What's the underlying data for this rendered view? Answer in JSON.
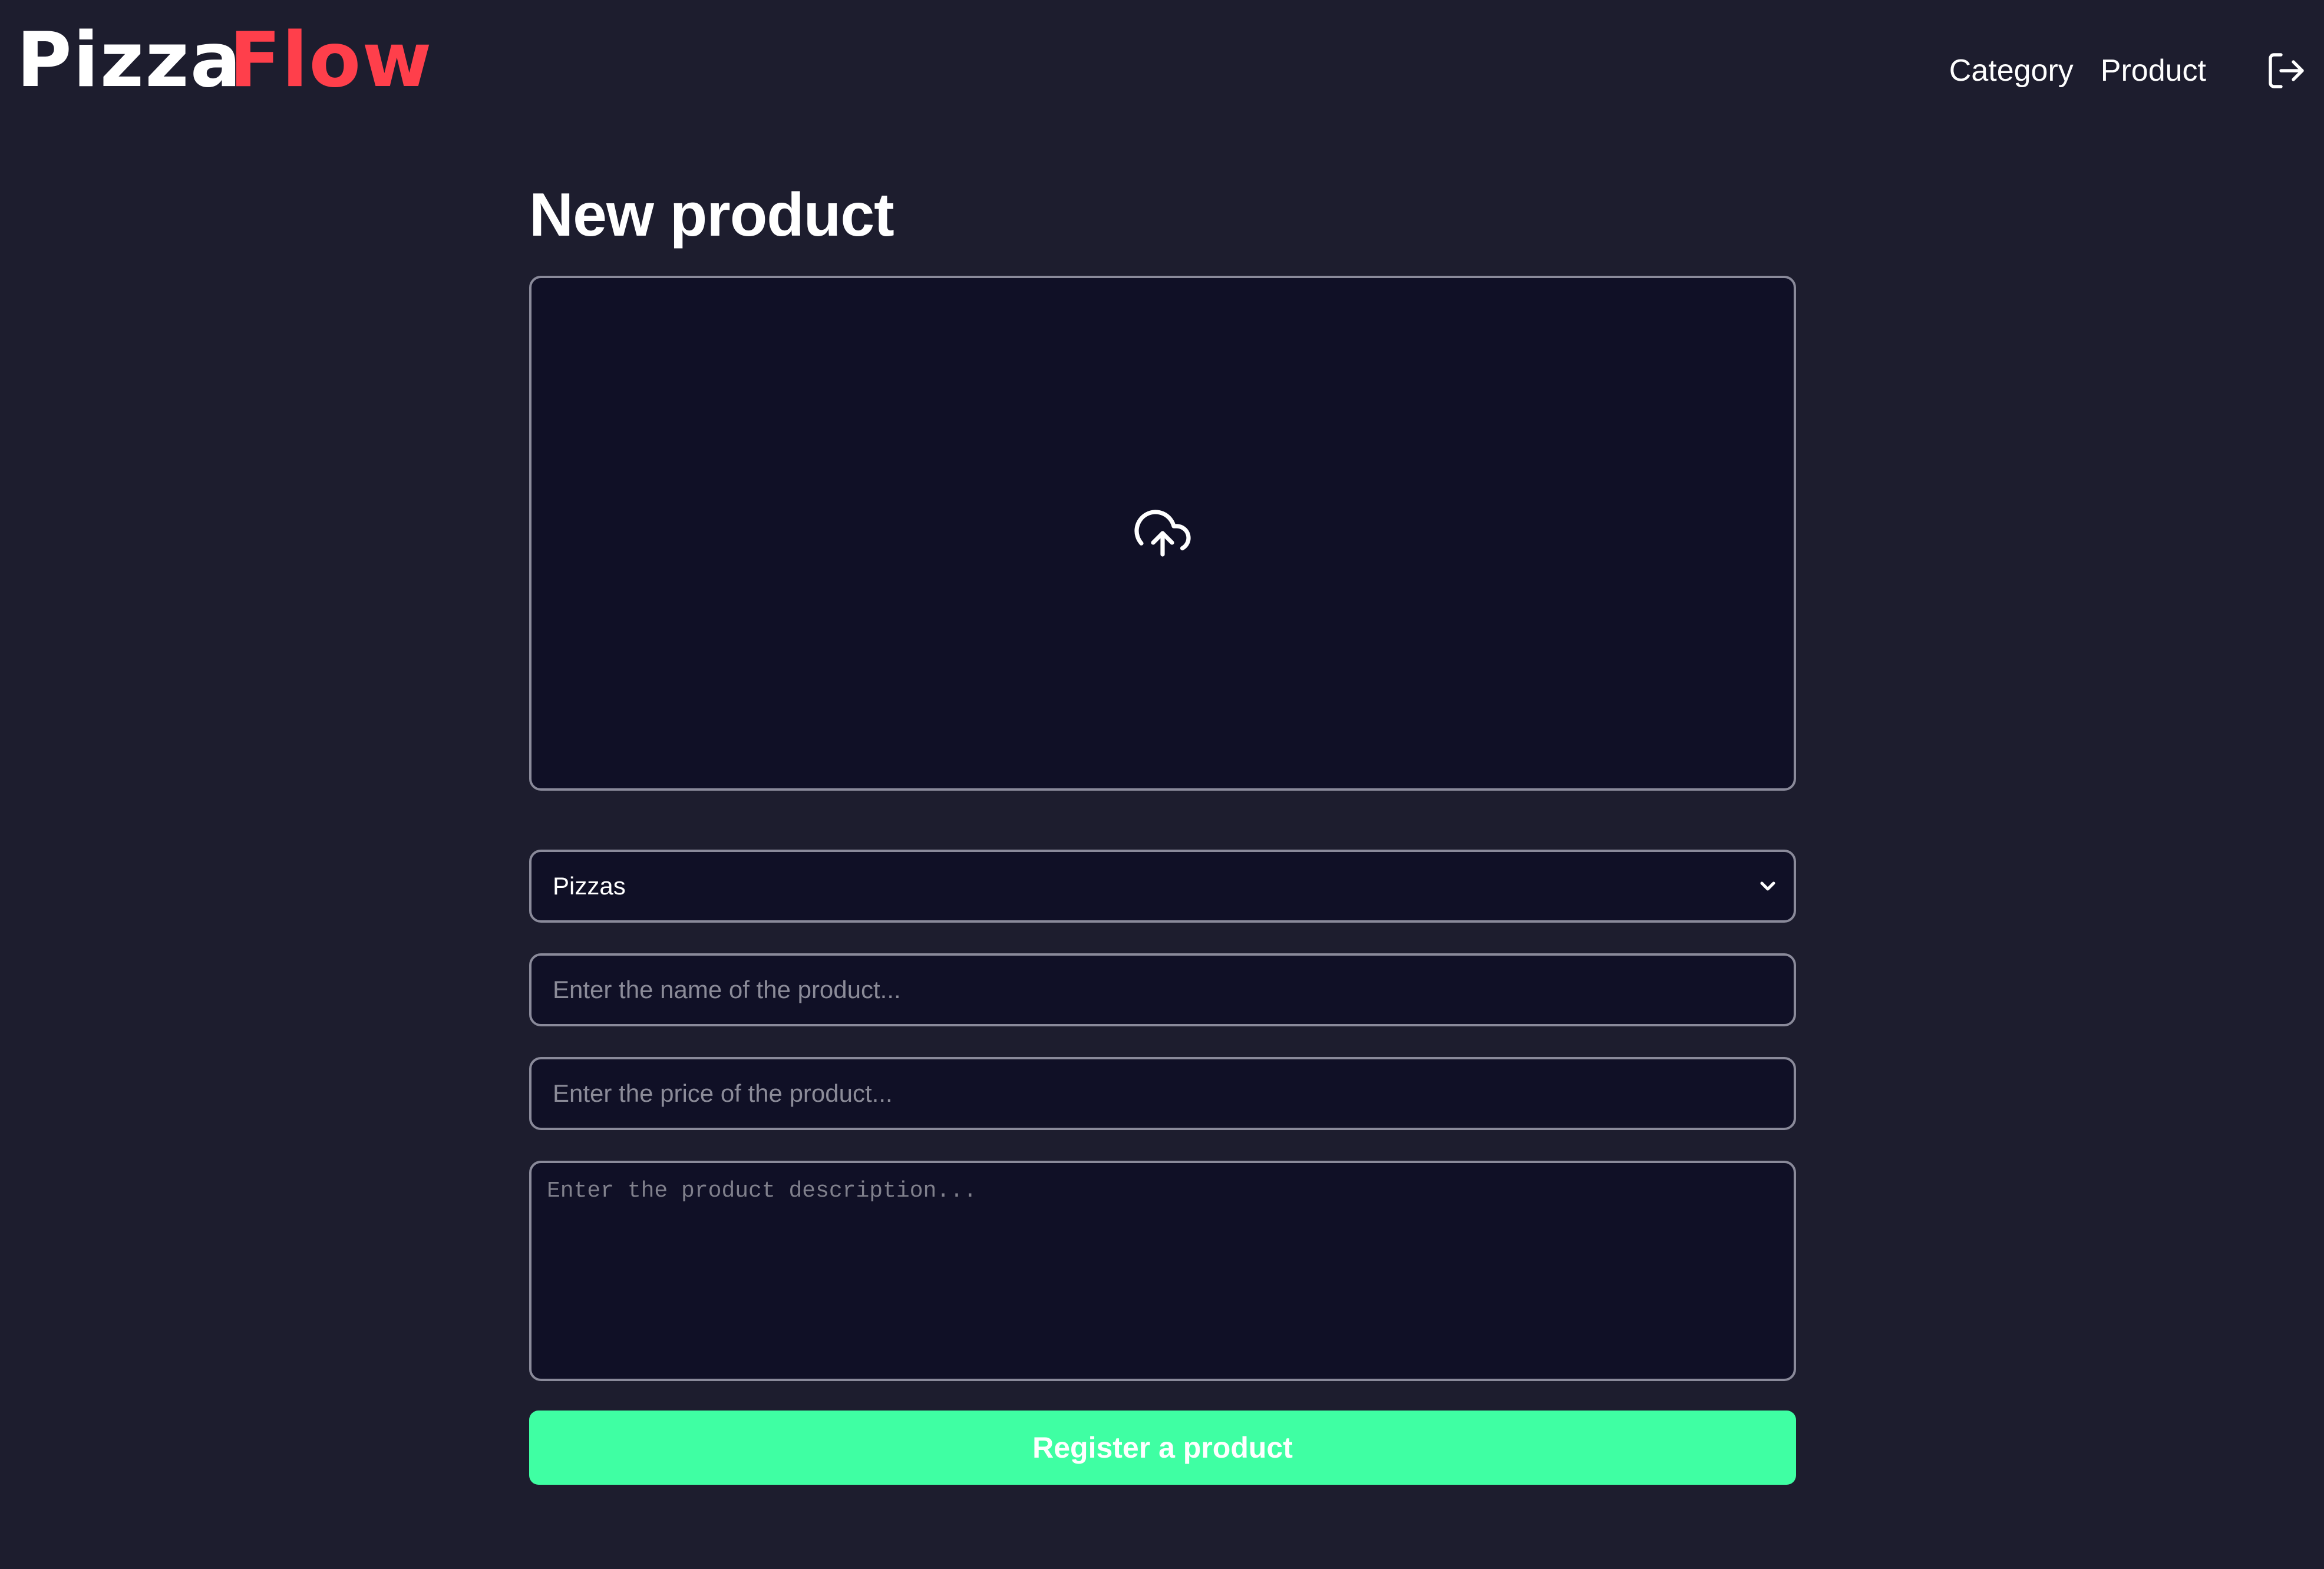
{
  "header": {
    "logo": {
      "part_1": "Pizza",
      "part_2": "Flow"
    },
    "nav": {
      "category_label": "Category",
      "product_label": "Product",
      "logout_icon": "logout-icon"
    }
  },
  "form": {
    "title": "New product",
    "upload_icon": "cloud-upload-icon",
    "category_select": {
      "selected": "Pizzas"
    },
    "name_input": {
      "value": "",
      "placeholder": "Enter the name of the product..."
    },
    "price_input": {
      "value": "",
      "placeholder": "Enter the price of the product..."
    },
    "description_input": {
      "value": "",
      "placeholder": "Enter the product description..."
    },
    "submit_label": "Register a product"
  },
  "colors": {
    "background": "#1d1d2e",
    "input_background": "#101026",
    "accent_red": "#ff3f4b",
    "accent_green": "#3fffa3",
    "border": "#8a8a9a"
  }
}
